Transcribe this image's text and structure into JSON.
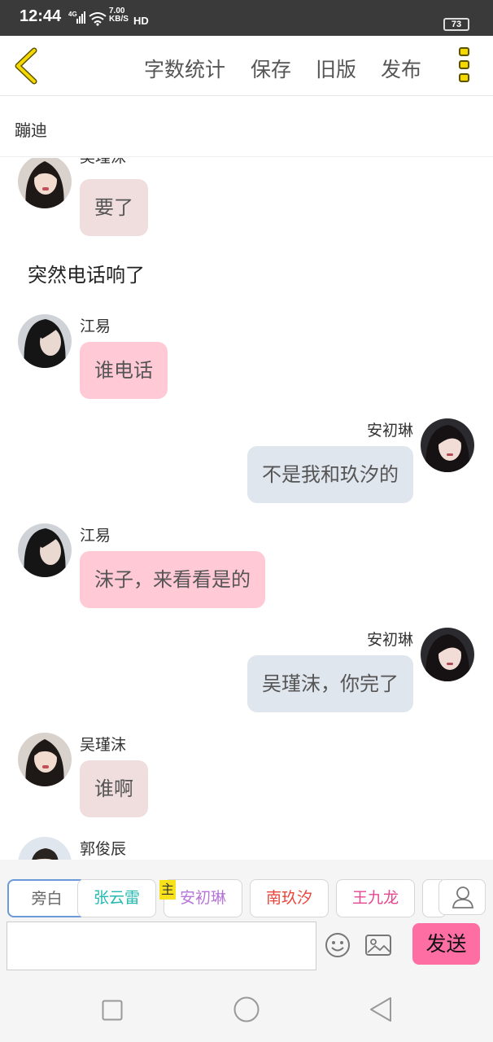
{
  "status": {
    "time": "12:44",
    "network": "4G",
    "speed_value": "7.00",
    "speed_unit": "KB/S",
    "hd": "HD",
    "battery": "73"
  },
  "toolbar": {
    "word_count": "字数统计",
    "save": "保存",
    "old_version": "旧版",
    "publish": "发布"
  },
  "story_title": "蹦迪",
  "messages": [
    {
      "type": "left",
      "name": "吴瑾沫",
      "text": "要了",
      "avatar": "avatar-wujinmo",
      "color": "#f0dede"
    },
    {
      "type": "narration",
      "text": "突然电话响了"
    },
    {
      "type": "left",
      "name": "江易",
      "text": "谁电话",
      "avatar": "avatar-jiangyi",
      "color": "#ffc9d6"
    },
    {
      "type": "right",
      "name": "安初琳",
      "text": "不是我和玖汐的",
      "avatar": "avatar-anchulin",
      "color": "#e0e6ee"
    },
    {
      "type": "left",
      "name": "江易",
      "text": "沫子，来看看是的",
      "avatar": "avatar-jiangyi",
      "color": "#ffc9d6"
    },
    {
      "type": "right",
      "name": "安初琳",
      "text": "吴瑾沫，你完了",
      "avatar": "avatar-anchulin",
      "color": "#e0e6ee"
    },
    {
      "type": "left",
      "name": "吴瑾沫",
      "text": "谁啊",
      "avatar": "avatar-wujinmo",
      "color": "#f0dede"
    },
    {
      "type": "left",
      "name": "郭俊辰",
      "text": "",
      "avatar": "avatar-guojunchen",
      "color": "#e8e8e8"
    }
  ],
  "characters": [
    {
      "name": "旁白",
      "color": "#666666"
    },
    {
      "name": "张云雷",
      "color": "#23b8b0"
    },
    {
      "name": "安初琳",
      "color": "#b675d8"
    },
    {
      "name": "南玖汐",
      "color": "#e8453c"
    },
    {
      "name": "王九龙",
      "color": "#e4478f"
    }
  ],
  "main_badge": "主",
  "input": {
    "value": "",
    "placeholder": ""
  },
  "send_label": "发送",
  "icons": {
    "back": "back-chevron-icon",
    "more": "more-vertical-icon",
    "emoji": "emoji-icon",
    "image": "image-icon",
    "person": "person-icon",
    "nav_recent": "recent-apps-icon",
    "nav_home": "home-icon",
    "nav_back": "back-triangle-icon"
  },
  "colors": {
    "accent": "#f5d800",
    "send": "#ff6ea3",
    "left_bubble_pink": "#ffc9d6",
    "left_bubble_light": "#f0dede",
    "right_bubble": "#e0e6ee"
  }
}
